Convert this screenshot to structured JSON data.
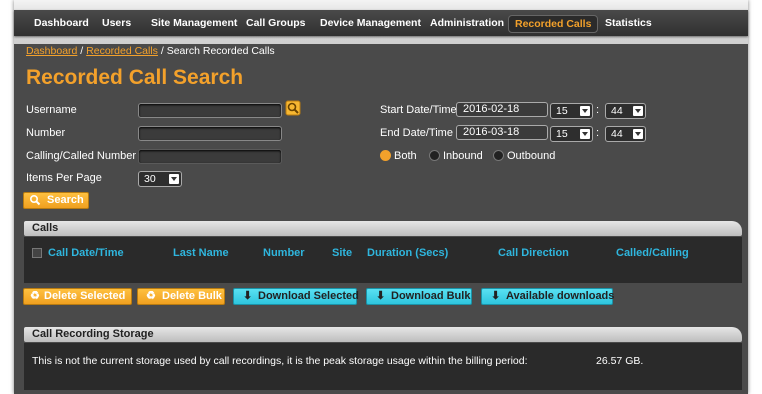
{
  "nav": {
    "items": [
      "Dashboard",
      "Users",
      "Site Management",
      "Call Groups",
      "Device Management",
      "Administration",
      "Recorded Calls",
      "Statistics"
    ],
    "active": "Recorded Calls"
  },
  "breadcrumb": {
    "link1": "Dashboard",
    "sep1": " / ",
    "link2": "Recorded Calls",
    "sep2": " / ",
    "current": "Search Recorded Calls"
  },
  "page_title": "Recorded Call Search",
  "form": {
    "username_label": "Username",
    "number_label": "Number",
    "calling_called_label": "Calling/Called Number",
    "items_per_page_label": "Items Per Page",
    "items_per_page_value": "30",
    "start_label": "Start Date/Time",
    "start_date": "2016-02-18",
    "start_hour": "15",
    "start_min": "44",
    "end_label": "End Date/Time",
    "end_date": "2016-03-18",
    "end_hour": "15",
    "end_min": "44",
    "time_sep": ":",
    "direction_options": [
      "Both",
      "Inbound",
      "Outbound"
    ],
    "direction_selected": "Both",
    "search_label": "Search"
  },
  "calls": {
    "title": "Calls",
    "columns": [
      "Call Date/Time",
      "Last Name",
      "Number",
      "Site",
      "Duration (Secs)",
      "Call Direction",
      "Called/Calling"
    ]
  },
  "actions": {
    "delete_selected": "Delete Selected",
    "delete_bulk": "Delete Bulk",
    "download_selected": "Download Selected",
    "download_bulk": "Download Bulk",
    "available_downloads": "Available downloads"
  },
  "storage": {
    "title": "Call Recording Storage",
    "text": "This is not the current storage used by call recordings, it is the peak storage usage within the billing period:",
    "value": "26.57 GB."
  },
  "colors": {
    "accent_orange": "#f3a12b",
    "accent_blue": "#2fb6de",
    "panel_bg": "#4a4a4a"
  }
}
